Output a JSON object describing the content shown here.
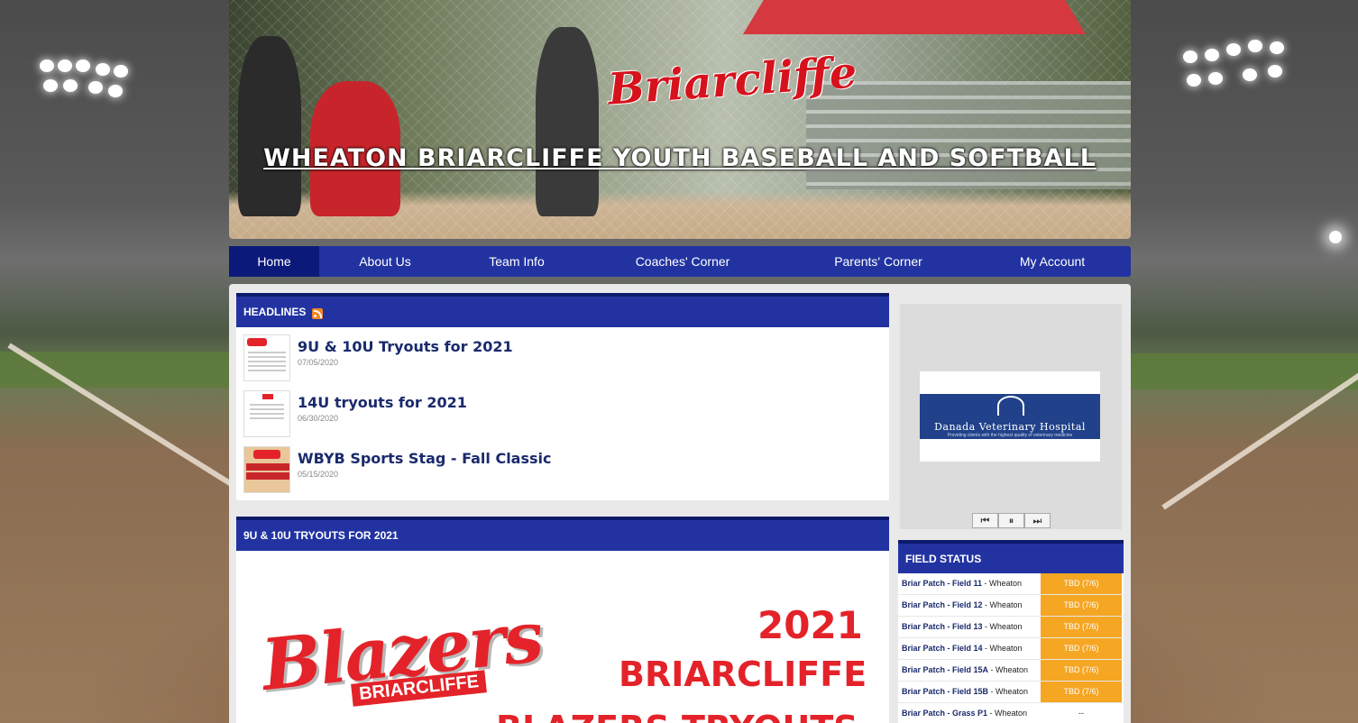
{
  "site": {
    "banner_title": "WHEATON BRIARCLIFFE YOUTH BASEBALL AND SOFTBALL",
    "logo_text": "Briarcliffe"
  },
  "nav": {
    "items": [
      {
        "label": "Home",
        "active": true
      },
      {
        "label": "About Us"
      },
      {
        "label": "Team Info"
      },
      {
        "label": "Coaches' Corner"
      },
      {
        "label": "Parents' Corner"
      },
      {
        "label": "My Account"
      }
    ]
  },
  "headlines": {
    "title": "HEADLINES",
    "items": [
      {
        "title": "9U & 10U Tryouts for 2021",
        "date": "07/05/2020"
      },
      {
        "title": "14U tryouts for 2021",
        "date": "06/30/2020"
      },
      {
        "title": "WBYB Sports Stag - Fall Classic",
        "date": "05/15/2020"
      }
    ]
  },
  "article": {
    "title": "9U & 10U TRYOUTS FOR 2021",
    "image": {
      "logo_text": "Blazers",
      "logo_sub": "BRIARCLIFFE",
      "year": "2021",
      "line1": "BRIARCLIFFE",
      "line2": "BLAZERS TRYOUTS"
    }
  },
  "sponsor": {
    "name": "Danada Veterinary Hospital",
    "tagline": "Providing clients with the highest quality of veterinary medicine",
    "controls": {
      "prev": "⏮",
      "pause": "⏸",
      "next": "⏭"
    }
  },
  "field_status": {
    "title": "FIELD STATUS",
    "rows": [
      {
        "field": "Briar Patch - Field 11",
        "location": " - Wheaton",
        "status": "TBD (7/6)"
      },
      {
        "field": "Briar Patch - Field 12",
        "location": " - Wheaton",
        "status": "TBD (7/6)"
      },
      {
        "field": "Briar Patch - Field 13",
        "location": " - Wheaton",
        "status": "TBD (7/6)"
      },
      {
        "field": "Briar Patch - Field 14",
        "location": " - Wheaton",
        "status": "TBD (7/6)"
      },
      {
        "field": "Briar Patch - Field 15A",
        "location": " - Wheaton",
        "status": "TBD (7/6)"
      },
      {
        "field": "Briar Patch - Field 15B",
        "location": " - Wheaton",
        "status": "TBD (7/6)"
      },
      {
        "field": "Briar Patch - Grass P1",
        "location": " - Wheaton",
        "status": "--"
      }
    ]
  },
  "colors": {
    "nav_blue": "#2233a1",
    "nav_active": "#0b1a7a",
    "status_orange": "#f5a623",
    "brand_red": "#e32329"
  }
}
